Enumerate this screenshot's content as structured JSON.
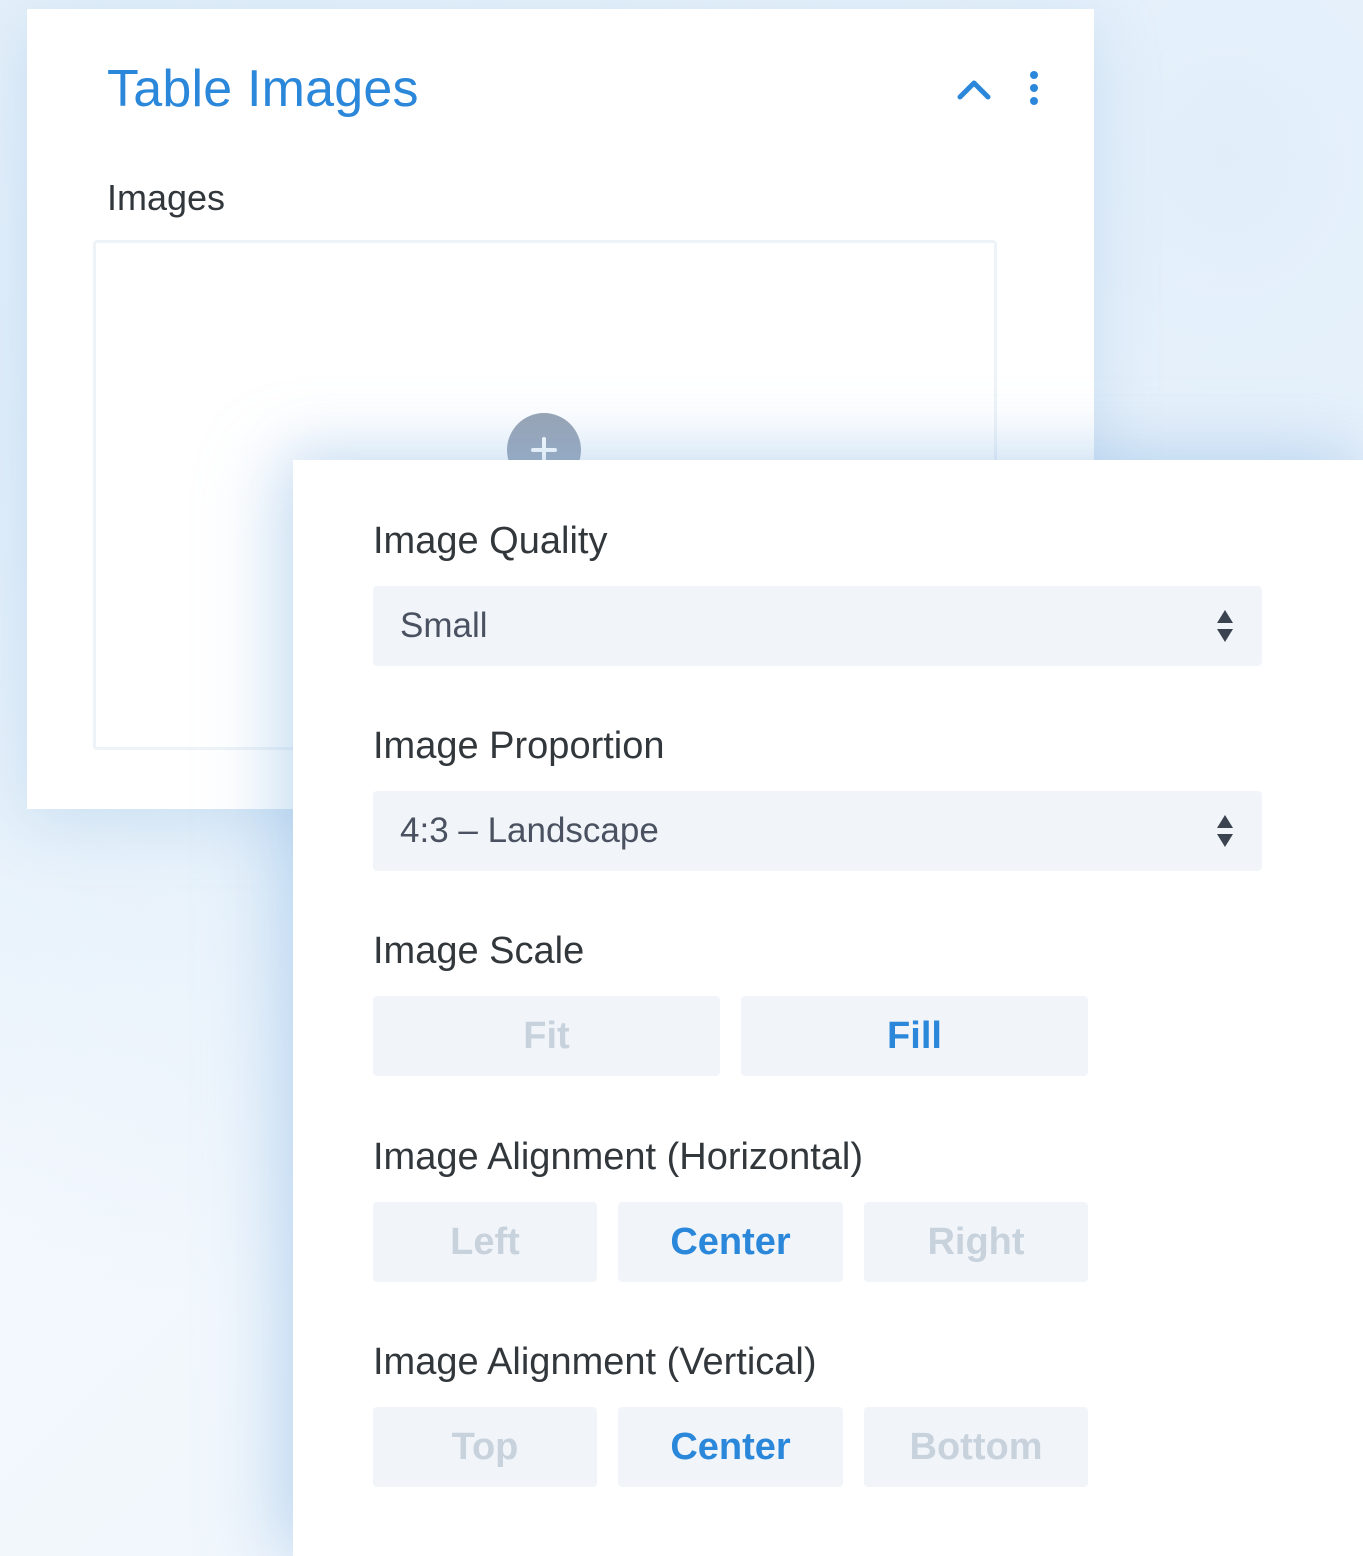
{
  "card": {
    "title": "Table Images",
    "collapse_icon": "chevron-up-icon",
    "menu_icon": "kebab-menu-icon",
    "images_label": "Images",
    "add_icon": "plus-icon"
  },
  "settings": {
    "image_quality": {
      "label": "Image Quality",
      "value": "Small"
    },
    "image_proportion": {
      "label": "Image Proportion",
      "value": "4:3 – Landscape"
    },
    "image_scale": {
      "label": "Image Scale",
      "options": [
        "Fit",
        "Fill"
      ],
      "selected": "Fill"
    },
    "align_horizontal": {
      "label": "Image Alignment (Horizontal)",
      "options": [
        "Left",
        "Center",
        "Right"
      ],
      "selected": "Center"
    },
    "align_vertical": {
      "label": "Image Alignment (Vertical)",
      "options": [
        "Top",
        "Center",
        "Bottom"
      ],
      "selected": "Center"
    }
  },
  "colors": {
    "accent": "#2b87da",
    "inactive_text": "#c8d2dd",
    "control_bg": "#f1f5f9",
    "label_text": "#32373c"
  }
}
